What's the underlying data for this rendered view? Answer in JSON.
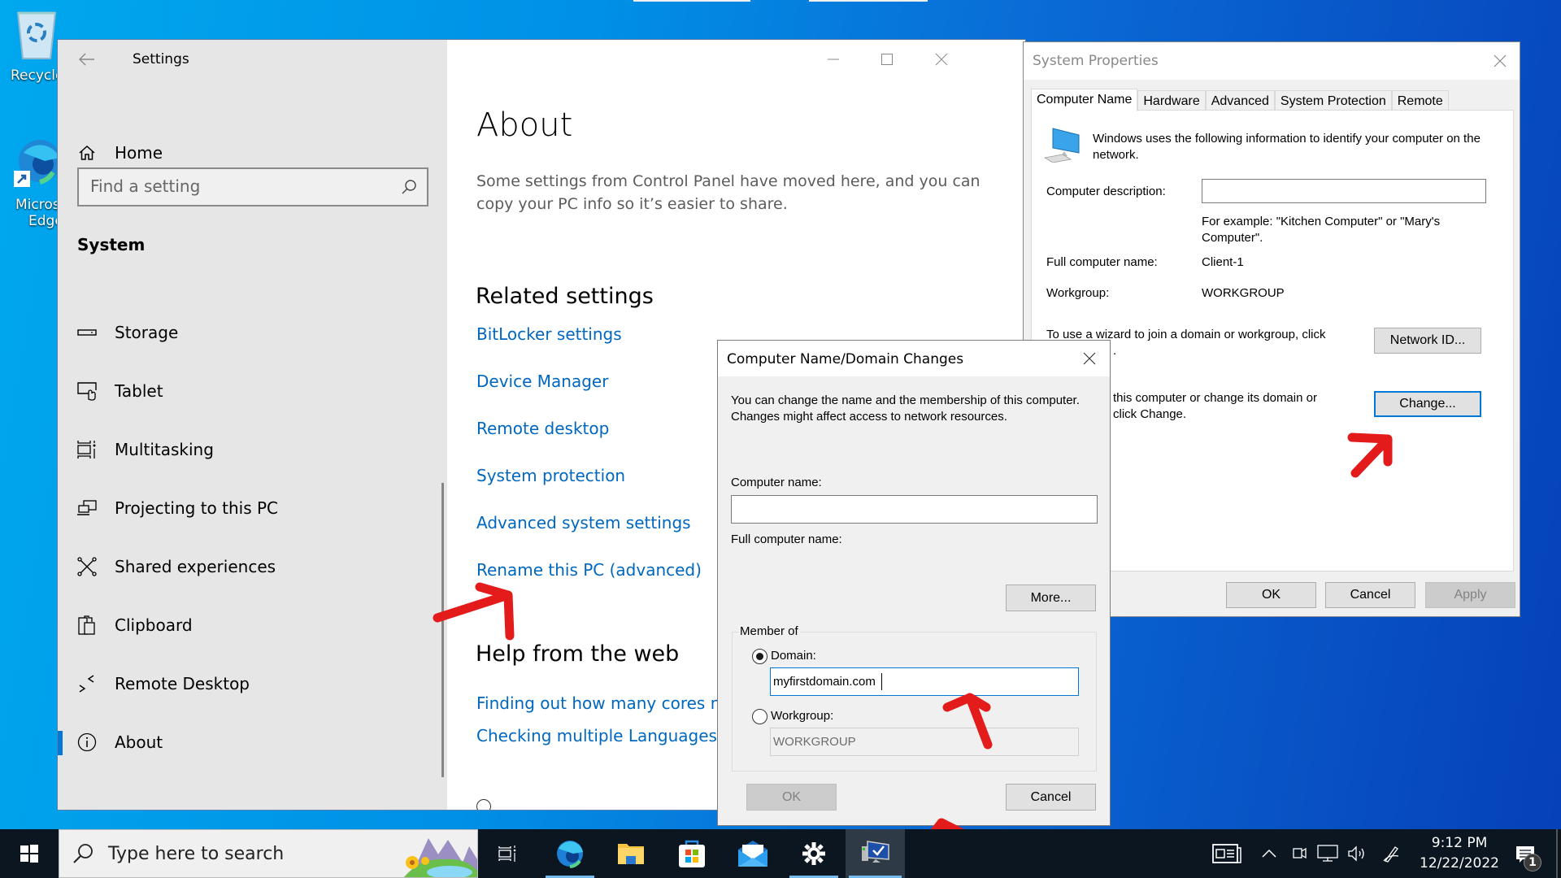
{
  "desktop": {
    "icons": [
      {
        "label": "Recycle Bin",
        "visible_label": "Recycle"
      },
      {
        "label": "Microsoft Edge",
        "visible_label_line1": "Micros",
        "visible_label_line2": "Edge"
      }
    ]
  },
  "settings": {
    "window_title": "Settings",
    "nav": {
      "home": "Home",
      "search_placeholder": "Find a setting",
      "section": "System",
      "items": [
        {
          "label": "Storage",
          "icon": "storage-icon"
        },
        {
          "label": "Tablet",
          "icon": "tablet-icon"
        },
        {
          "label": "Multitasking",
          "icon": "multitasking-icon"
        },
        {
          "label": "Projecting to this PC",
          "icon": "projecting-icon"
        },
        {
          "label": "Shared experiences",
          "icon": "shared-experiences-icon"
        },
        {
          "label": "Clipboard",
          "icon": "clipboard-icon"
        },
        {
          "label": "Remote Desktop",
          "icon": "remote-desktop-icon"
        },
        {
          "label": "About",
          "icon": "info-icon",
          "active": true
        }
      ]
    },
    "content": {
      "title": "About",
      "description": "Some settings from Control Panel have moved here, and you can copy your PC info so it’s easier to share.",
      "related_heading": "Related settings",
      "related_links": [
        "BitLocker settings",
        "Device Manager",
        "Remote desktop",
        "System protection",
        "Advanced system settings",
        "Rename this PC (advanced)"
      ],
      "help_heading": "Help from the web",
      "help_links": [
        "Finding out how many cores my",
        "Checking multiple Languages su"
      ]
    }
  },
  "system_properties": {
    "title": "System Properties",
    "tabs": [
      "Computer Name",
      "Hardware",
      "Advanced",
      "System Protection",
      "Remote"
    ],
    "active_tab": "Computer Name",
    "intro": "Windows uses the following information to identify your computer on the network.",
    "description_label": "Computer description:",
    "description_value": "",
    "example_text": "For example: \"Kitchen Computer\" or \"Mary's Computer\".",
    "full_name_label": "Full computer name:",
    "full_name_value": "Client-1",
    "workgroup_label": "Workgroup:",
    "workgroup_value": "WORKGROUP",
    "wizard_text": "To use a wizard to join a domain or workgroup, click",
    "wizard_text_tail": ".",
    "network_id_button": "Network ID...",
    "rename_text_line1": "this computer or change its domain or",
    "rename_text_line2": "click Change.",
    "change_button": "Change...",
    "ok_button": "OK",
    "cancel_button": "Cancel",
    "apply_button": "Apply"
  },
  "domain_dialog": {
    "title": "Computer Name/Domain Changes",
    "intro": "You can change the name and the membership of this computer. Changes might affect access to network resources.",
    "computer_name_label": "Computer name:",
    "computer_name_value": "",
    "full_name_label": "Full computer name:",
    "full_name_value": "",
    "more_button": "More...",
    "member_of_label": "Member of",
    "domain_label": "Domain:",
    "domain_value": "myfirstdomain.com",
    "domain_selected": true,
    "workgroup_label": "Workgroup:",
    "workgroup_value": "WORKGROUP",
    "ok_button": "OK",
    "cancel_button": "Cancel"
  },
  "taskbar": {
    "search_placeholder": "Type here to search",
    "apps": [
      "Task View",
      "Microsoft Edge",
      "File Explorer",
      "Microsoft Store",
      "Mail",
      "Settings",
      "System Properties"
    ],
    "time": "9:12 PM",
    "date": "12/22/2022",
    "notification_count": "1"
  },
  "colors": {
    "accent": "#0078d7",
    "link": "#0067c0",
    "annotation": "#e31b1b"
  }
}
